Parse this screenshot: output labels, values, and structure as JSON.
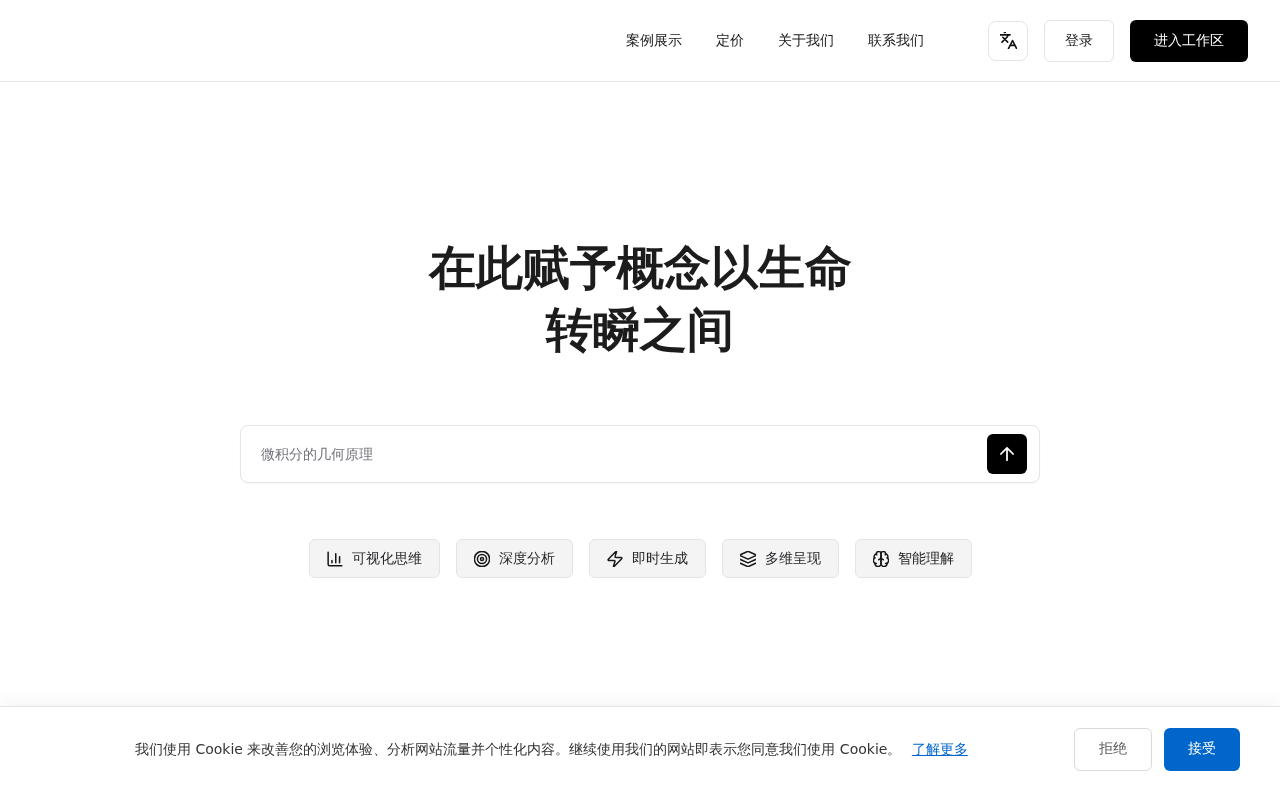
{
  "header": {
    "nav": [
      {
        "label": "案例展示"
      },
      {
        "label": "定价"
      },
      {
        "label": "关于我们"
      },
      {
        "label": "联系我们"
      }
    ],
    "login_button": "登录",
    "workspace_button": "进入工作区"
  },
  "hero": {
    "title_lines": [
      "在此赋予概念以生命",
      "转瞬之间"
    ],
    "search": {
      "placeholder": "微积分的几何原理"
    },
    "chips": [
      {
        "label": "可视化思维"
      },
      {
        "label": "深度分析"
      },
      {
        "label": "即时生成"
      },
      {
        "label": "多维呈现"
      },
      {
        "label": "智能理解"
      }
    ]
  },
  "cookie_banner": {
    "message": "我们使用 Cookie 来改善您的浏览体验、分析网站流量并个性化内容。继续使用我们的网站即表示您同意我们使用 Cookie。",
    "link": "了解更多",
    "buttons": [
      {
        "label": "拒绝",
        "kind": "secondary"
      },
      {
        "label": "接受",
        "kind": "primary"
      }
    ]
  }
}
